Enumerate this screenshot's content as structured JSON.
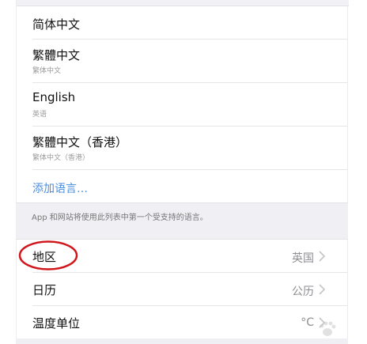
{
  "languages": {
    "items": [
      {
        "title": "简体中文",
        "subtitle": ""
      },
      {
        "title": "繁體中文",
        "subtitle": "繁体中文"
      },
      {
        "title": "English",
        "subtitle": "英语"
      },
      {
        "title": "繁體中文（香港）",
        "subtitle": "繁体中文（香港）"
      }
    ],
    "add_label": "添加语言…"
  },
  "footer": {
    "note": "App 和网站将使用此列表中第一个受支持的语言。"
  },
  "settings": {
    "rows": [
      {
        "title": "地区",
        "value": "英国"
      },
      {
        "title": "日历",
        "value": "公历"
      },
      {
        "title": "温度单位",
        "value": "°C"
      }
    ]
  },
  "colors": {
    "link": "#4a8ee0",
    "annotation_circle": "#d0161b",
    "background": "#ffffff",
    "group_band": "#f0f0f4",
    "secondary_text": "#8e8e93"
  },
  "icons": {
    "chevron": "chevron-right-icon",
    "watermark": "baidu-paw-icon"
  }
}
